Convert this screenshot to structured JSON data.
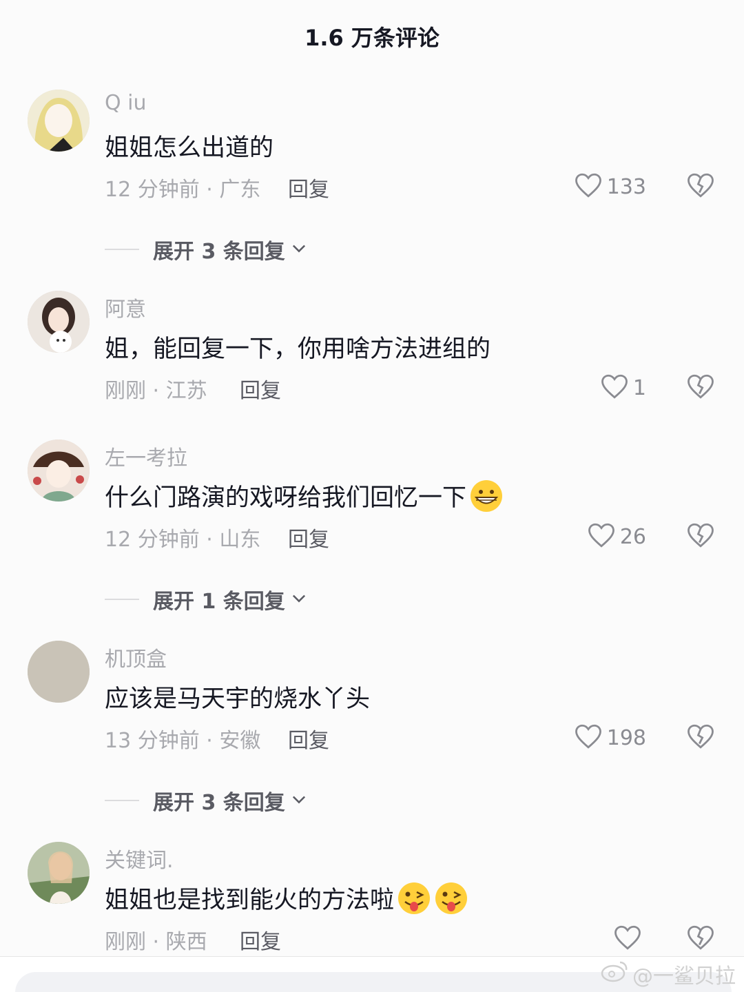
{
  "header": {
    "title": "1.6 万条评论"
  },
  "comments": [
    {
      "username": "Q iu",
      "text": "姐姐怎么出道的",
      "meta": "12 分钟前 · 广东",
      "reply_label": "回复",
      "likes": "133",
      "expand_label": "展开 3 条回复"
    },
    {
      "username": "阿意",
      "text": "姐，能回复一下，你用啥方法进组的",
      "meta": "刚刚 · 江苏",
      "reply_label": "回复",
      "likes": "1",
      "expand_label": ""
    },
    {
      "username": "左一考拉",
      "text": "什么门路演的戏呀给我们回忆一下",
      "meta": "12 分钟前 · 山东",
      "reply_label": "回复",
      "likes": "26",
      "expand_label": "展开 1 条回复",
      "emojis": [
        "grin-emoji"
      ]
    },
    {
      "username": "机顶盒",
      "text": "应该是马天宇的烧水丫头",
      "meta": "13 分钟前 · 安徽",
      "reply_label": "回复",
      "likes": "198",
      "expand_label": "展开 3 条回复"
    },
    {
      "username": "关键词.",
      "text": "姐姐也是找到能火的方法啦",
      "meta": "刚刚 · 陕西",
      "reply_label": "回复",
      "likes": "",
      "expand_label": "",
      "emojis": [
        "tongue-wink-emoji",
        "tongue-wink-emoji"
      ]
    }
  ],
  "watermark": "@一鲨贝拉",
  "icons": {
    "like": "heart-outline-icon",
    "dislike": "broken-heart-icon",
    "expand": "chevron-down-icon"
  },
  "colors": {
    "muted": "#a8a9ae",
    "text": "#161823",
    "reply": "#5a5b63"
  }
}
